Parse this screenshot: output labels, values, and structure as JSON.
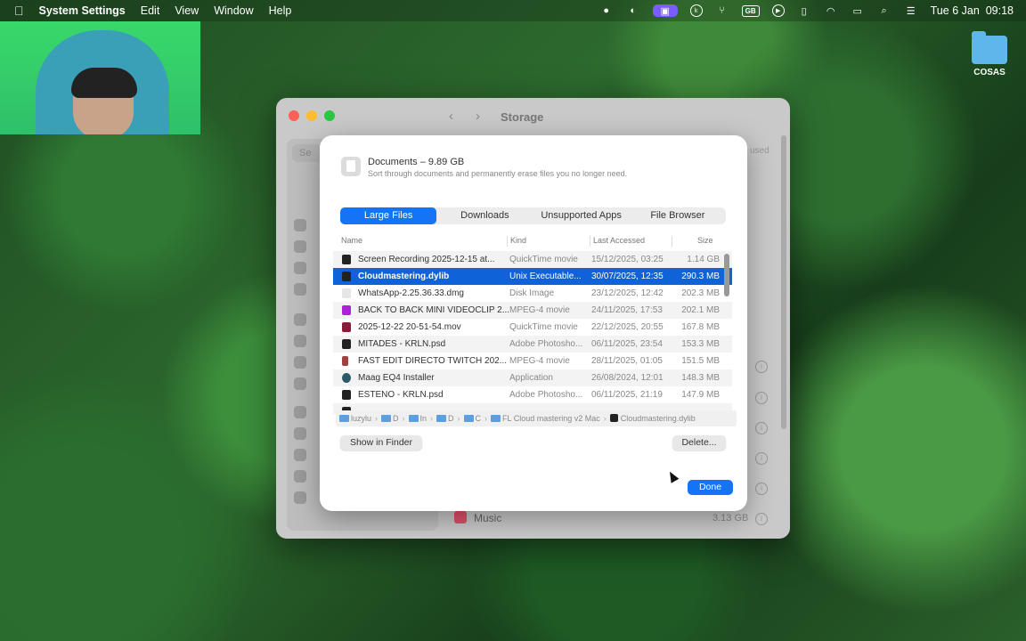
{
  "menubar": {
    "apple_icon": "apple-icon",
    "app_name": "System Settings",
    "menus": [
      "Edit",
      "View",
      "Window",
      "Help"
    ],
    "status_icons": [
      "dot-icon",
      "nvidia-icon",
      "screen-record-icon",
      "k-icon",
      "fork-icon",
      "keyboard-layout-icon",
      "play-icon",
      "clipboard-icon",
      "wifi-icon",
      "battery-icon",
      "search-icon",
      "control-center-icon"
    ],
    "keyboard_layout": "GB",
    "k_label": "k",
    "clock": "Tue 6 Jan  09:18"
  },
  "desktop": {
    "folder_label": "COSAS"
  },
  "window": {
    "title": "Storage",
    "search_placeholder": "Se",
    "music_label": "Music",
    "music_size": "3.13 GB",
    "faint_right": "used"
  },
  "sheet": {
    "category_title": "Documents",
    "category_size": "9.89 GB",
    "subtitle": "Sort through documents and permanently erase files you no longer need.",
    "tabs": [
      "Large Files",
      "Downloads",
      "Unsupported Apps",
      "File Browser"
    ],
    "columns": {
      "name": "Name",
      "kind": "Kind",
      "last_accessed": "Last Accessed",
      "size": "Size"
    },
    "rows": [
      {
        "name": "Screen Recording 2025-12-15 at...",
        "kind": "QuickTime movie",
        "accessed": "15/12/2025, 03:25",
        "size": "1.14 GB"
      },
      {
        "name": "Cloudmastering.dylib",
        "kind": "Unix Executable...",
        "accessed": "30/07/2025, 12:35",
        "size": "290.3 MB"
      },
      {
        "name": "WhatsApp-2.25.36.33.dmg",
        "kind": "Disk Image",
        "accessed": "23/12/2025, 12:42",
        "size": "202.3 MB"
      },
      {
        "name": "BACK TO BACK MINI VIDEOCLIP 2...",
        "kind": "MPEG-4 movie",
        "accessed": "24/11/2025, 17:53",
        "size": "202.1 MB"
      },
      {
        "name": "2025-12-22 20-51-54.mov",
        "kind": "QuickTime movie",
        "accessed": "22/12/2025, 20:55",
        "size": "167.8 MB"
      },
      {
        "name": "MITADES - KRLN.psd",
        "kind": "Adobe Photosho...",
        "accessed": "06/11/2025, 23:54",
        "size": "153.3 MB"
      },
      {
        "name": "FAST EDIT DIRECTO TWITCH 202...",
        "kind": "MPEG-4 movie",
        "accessed": "28/11/2025, 01:05",
        "size": "151.5 MB"
      },
      {
        "name": "Maag EQ4 Installer",
        "kind": "Application",
        "accessed": "26/08/2024, 12:01",
        "size": "148.3 MB"
      },
      {
        "name": "ESTENO - KRLN.psd",
        "kind": "Adobe Photosho...",
        "accessed": "06/11/2025, 21:19",
        "size": "147.9 MB"
      }
    ],
    "path": [
      "luzylu",
      "D",
      "In",
      "D",
      "C",
      "FL Cloud mastering v2 Mac",
      "Cloudmastering.dylib"
    ],
    "show_in_finder": "Show in Finder",
    "delete": "Delete...",
    "done": "Done"
  },
  "colors": {
    "accent": "#1474f5",
    "selection": "#1062d9"
  }
}
